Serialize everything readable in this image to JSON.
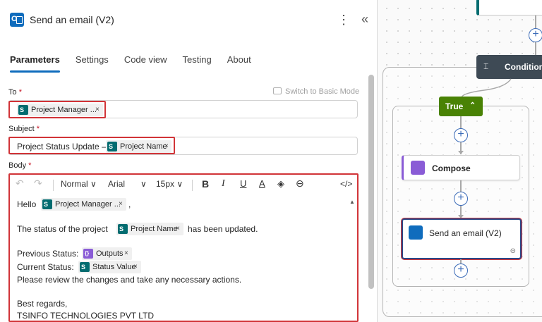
{
  "panel": {
    "title": "Send an email (V2)",
    "more_icon": "⋮",
    "collapse_icon": "«",
    "tabs": [
      {
        "label": "Parameters",
        "active": true
      },
      {
        "label": "Settings",
        "active": false
      },
      {
        "label": "Code view",
        "active": false
      },
      {
        "label": "Testing",
        "active": false
      },
      {
        "label": "About",
        "active": false
      }
    ],
    "switch_mode_label": "Switch to Basic Mode"
  },
  "fields": {
    "to": {
      "label": "To",
      "required_mark": "*",
      "token": "Project Manager ..."
    },
    "subject": {
      "label": "Subject",
      "required_mark": "*",
      "prefix_text": "Project Status Update – ",
      "token": "Project Name"
    },
    "body": {
      "label": "Body",
      "required_mark": "*"
    }
  },
  "toolbar": {
    "undo_icon": "↶",
    "redo_icon": "↷",
    "paragraph_style": "Normal",
    "font": "Arial",
    "font_size": "15px",
    "bold": "B",
    "italic": "I",
    "underline": "U",
    "font_color_icon": "A",
    "highlight_icon": "◈",
    "link_icon": "⊖",
    "code_view_icon": "</>",
    "dropdown_icon": "∨"
  },
  "body_content": {
    "line1_prefix": "Hello",
    "line1_token": "Project Manager ...",
    "line1_suffix": ",",
    "line2_prefix": "The status of the project",
    "line2_token": "Project Name",
    "line2_suffix": "has been updated.",
    "line3_prefix": "Previous Status:",
    "line3_token": "Outputs",
    "line4_prefix": "Current Status:",
    "line4_token": "Status Value",
    "line5": "Please review the changes and take any necessary actions.",
    "line6": "Best regards,",
    "line7": "TSINFO TECHNOLOGIES PVT LTD"
  },
  "token_remove": "×",
  "canvas": {
    "condition_label": "Condition",
    "condition_icon": "⌶",
    "true_label": "True",
    "true_chevron": "⌃",
    "compose_label": "Compose",
    "send_email_label": "Send an email (V2)",
    "plus": "+",
    "link_icon": "⊝"
  },
  "colors": {
    "accent": "#0f6cbd",
    "highlight_border": "#d13438",
    "sharepoint": "#036c70",
    "compose": "#8a5cd6",
    "true_branch": "#498205",
    "condition_header": "#3e4a55"
  }
}
